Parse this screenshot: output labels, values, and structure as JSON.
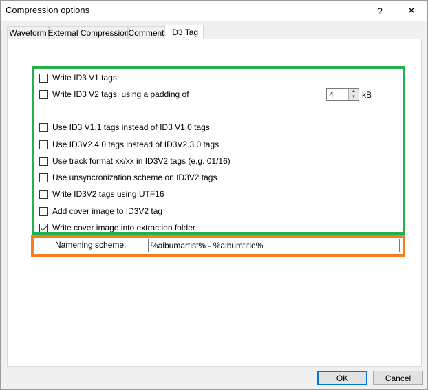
{
  "window": {
    "title": "Compression options",
    "help_label": "?",
    "close_label": "✕"
  },
  "tabs": [
    {
      "label": "Waveform",
      "active": false
    },
    {
      "label": "External Compression",
      "active": false
    },
    {
      "label": "Comment",
      "active": false
    },
    {
      "label": "ID3 Tag",
      "active": true
    }
  ],
  "options": [
    {
      "label": "Write ID3 V1 tags",
      "checked": false
    },
    {
      "label": "Write ID3 V2 tags, using a padding of",
      "checked": false
    },
    {
      "label": "Use ID3 V1.1 tags instead of ID3 V1.0 tags",
      "checked": false
    },
    {
      "label": "Use ID3V2.4.0 tags instead of ID3V2.3.0 tags",
      "checked": false
    },
    {
      "label": "Use track format xx/xx in ID3V2 tags (e.g. 01/16)",
      "checked": false
    },
    {
      "label": "Use unsyncronization scheme on ID3V2 tags",
      "checked": false
    },
    {
      "label": "Write ID3V2 tags using UTF16",
      "checked": false
    },
    {
      "label": "Add cover image to ID3V2 tag",
      "checked": false
    },
    {
      "label": "Write cover image into extraction folder",
      "checked": true
    }
  ],
  "padding": {
    "value": "4",
    "unit": "kB"
  },
  "naming": {
    "label": "Namening scheme:",
    "value": "%albumartist% - %albumtitle%"
  },
  "buttons": {
    "ok": "OK",
    "cancel": "Cancel"
  },
  "highlight_colors": {
    "green": "#22b14c",
    "orange": "#f47f20",
    "default_button": "#0078d7"
  }
}
